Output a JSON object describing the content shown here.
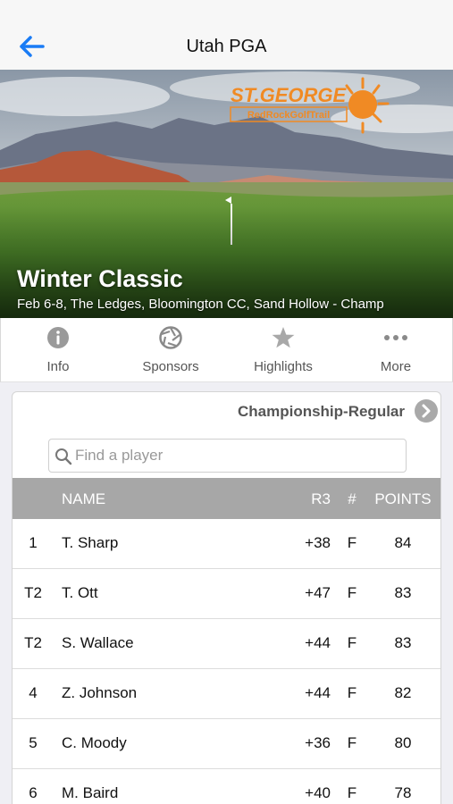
{
  "nav": {
    "title": "Utah PGA"
  },
  "hero": {
    "title": "Winter Classic",
    "subtitle": "Feb 6-8, The Ledges, Bloomington CC, Sand Hollow - Champ",
    "logo_line1": "ST.GEORGE",
    "logo_line2": "RedRockGolfTrail"
  },
  "tabs": [
    {
      "label": "Info",
      "icon": "info-icon"
    },
    {
      "label": "Sponsors",
      "icon": "aperture-icon"
    },
    {
      "label": "Highlights",
      "icon": "star-icon"
    },
    {
      "label": "More",
      "icon": "more-dots-icon"
    }
  ],
  "leaderboard": {
    "division": "Championship-Regular",
    "search_placeholder": "Find a player",
    "columns": {
      "pos": "",
      "name": "NAME",
      "r3": "R3",
      "thru": "#",
      "points": "POINTS"
    },
    "rows": [
      {
        "pos": "1",
        "name": "T. Sharp",
        "r3": "+38",
        "thru": "F",
        "points": "84"
      },
      {
        "pos": "T2",
        "name": "T. Ott",
        "r3": "+47",
        "thru": "F",
        "points": "83"
      },
      {
        "pos": "T2",
        "name": "S. Wallace",
        "r3": "+44",
        "thru": "F",
        "points": "83"
      },
      {
        "pos": "4",
        "name": "Z. Johnson",
        "r3": "+44",
        "thru": "F",
        "points": "82"
      },
      {
        "pos": "5",
        "name": "C. Moody",
        "r3": "+36",
        "thru": "F",
        "points": "80"
      },
      {
        "pos": "6",
        "name": "M. Baird",
        "r3": "+40",
        "thru": "F",
        "points": "78"
      }
    ]
  },
  "colors": {
    "accent": "#1a7cf5",
    "header_grey": "#a7a7a7",
    "logo_orange": "#f08a24"
  }
}
